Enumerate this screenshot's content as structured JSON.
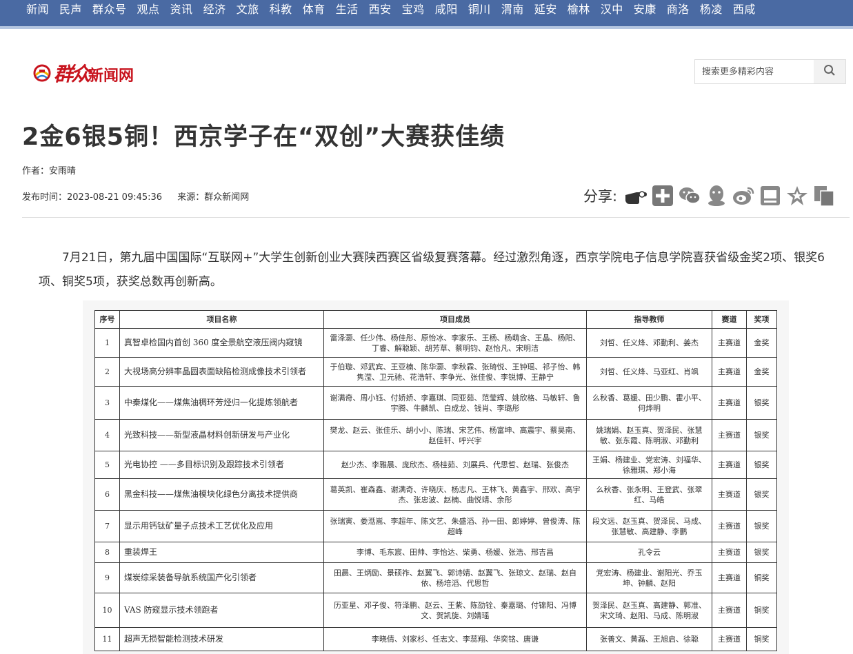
{
  "nav": [
    "新闻",
    "民声",
    "群众号",
    "观点",
    "资讯",
    "经济",
    "文旅",
    "科教",
    "体育",
    "生活",
    "西安",
    "宝鸡",
    "咸阳",
    "铜川",
    "渭南",
    "延安",
    "榆林",
    "汉中",
    "安康",
    "商洛",
    "杨凌",
    "西咸"
  ],
  "logo": {
    "text_brush": "群众",
    "text_plain": "新闻网",
    "color": "#c8141e"
  },
  "search": {
    "placeholder": "搜索更多精彩内容",
    "icon": "search-icon"
  },
  "article": {
    "title": "2金6银5铜！西京学子在“双创”大赛获佳绩",
    "author": "作者：安雨晴",
    "published": "发布时间：2023-08-21 09:45:36",
    "source": "来源：群众新闻网",
    "intro": "7月21日，第九届中国国际“互联网+”大学生创新创业大赛陕西赛区省级复赛落幕。经过激烈角逐，西京学院电子信息学院喜获省级金奖2项、银奖6项、铜奖5项，获奖总数再创新高。"
  },
  "share": {
    "label": "分享:",
    "icons": [
      "hand-pointer-icon",
      "plus-share-icon",
      "wechat-icon",
      "qq-icon",
      "weibo-icon",
      "qzone-icon",
      "star-favorite-icon",
      "copy-icon"
    ]
  },
  "table": {
    "headers": [
      "序号",
      "项目名称",
      "项目成员",
      "指导教师",
      "赛道",
      "奖项"
    ],
    "rows": [
      [
        "1",
        "真智卓检国内首创 360 度全景航空液压阀内窥镜",
        "雷泽灏、任少伟、杨佳彤、原怡冰、李家乐、王杨、杨萌含、王晶、杨阳、丁睿、解聪颖、胡芳草、蔡明钧、赵怡凡、宋明洁",
        "刘哲、任义烽、邓勤利、姜杰",
        "主赛道",
        "金奖"
      ],
      [
        "2",
        "大视场高分辨率晶圆表面缺陷检测成像技术引领者",
        "于伯璇、邓武宾、王亚楠、陈华灏、李秋霖、张琦悦、王钟瑶、祁子怡、韩隽滢、卫元驰、花浩轩、李争光、张佳俊、李锐博、王静宁",
        "刘哲、任义烽、马亚红、肖飒",
        "主赛道",
        "金奖"
      ],
      [
        "3",
        "中秦煤化——煤焦油稠环芳烃归一化提炼领航者",
        "谢满奇、周小钰、付娇娇、李嘉琪、同亚茹、范莹辉、姚欣格、马敏轩、鲁宇腾、牛麟凯、白成龙、钱肖、李璐彤",
        "么秋香、葛媛、田少鹏、霍小平、何烨明",
        "主赛道",
        "银奖"
      ],
      [
        "4",
        "光致科技——新型液晶材料创新研发与产业化",
        "樊龙、赵云、张佳乐、胡小小、陈瑞、宋艺伟、杨富坤、高震宇、蔡昊南、赵佳轩、呼兴宇",
        "姚瑞娟、赵玉真、贺泽民、张慧敏、张东霞、陈明淑、邓勤利",
        "主赛道",
        "银奖"
      ],
      [
        "5",
        "光电协控 ——多目标识别及跟踪技术引领者",
        "赵少杰、李雅晨、庞欣杰、杨桂茹、刘展兵、代思哲、赵瑞、张俊杰",
        "王娟、杨建业、党宏涛、刘福华、徐雅琪、郑小海",
        "主赛道",
        "银奖"
      ],
      [
        "6",
        "黑金科技——煤焦油模块化绿色分离技术提供商",
        "葛英凯、崔森鑫、谢满奇、许晓庆、杨志凡、王林飞、黄鑫宇、邢欢、高宇杰、张忠波、赵楠、曲悦靖、余彤",
        "么秋香、张永明、王登武、张翠红、马皓",
        "主赛道",
        "银奖"
      ],
      [
        "7",
        "显示用钙钛矿量子点技术工艺优化及应用",
        "张瑞寅、娄湉嵩、李超年、陈文艺、朱盛滔、孙一田、郎婷婷、曾俊涛、陈超峰",
        "段文远、赵玉真、贺泽民、马成、张慧敏、高建静、李鹏",
        "主赛道",
        "银奖"
      ],
      [
        "8",
        "重装焊王",
        "李博、毛东宸、田帅、李怡达、柴勇、杨媛、张浩、邢吉昌",
        "孔令云",
        "主赛道",
        "银奖"
      ],
      [
        "9",
        "煤炭综采装备导航系统国产化引领者",
        "田晨、王炳励、景硕祚、赵翼飞、郭诗婧、赵翼飞、张琼文、赵瑞、赵自依、杨培滔、代思哲",
        "党宏涛、杨建业、谢阳光、乔玉坤、钟麟、赵阳",
        "主赛道",
        "铜奖"
      ],
      [
        "10",
        "VAS 防窥显示技术领跑者",
        "历亚星、邓子俊、符泽鹏、赵云、王紫、陈劭铨、秦嘉璐、付锦阳、冯博文、贺凯旋、刘婧瑶",
        "贺泽民、赵玉真、高建静、郭准、宋文琦、赵阳、马成、陈明淑",
        "主赛道",
        "铜奖"
      ],
      [
        "11",
        "超声无损智能检测技术研发",
        "李晓倩、刘家杉、任志文、李蕊翔、华奕铭、唐谦",
        "张善文、黄磊、王旭启、徐聪",
        "主赛道",
        "铜奖"
      ]
    ]
  }
}
